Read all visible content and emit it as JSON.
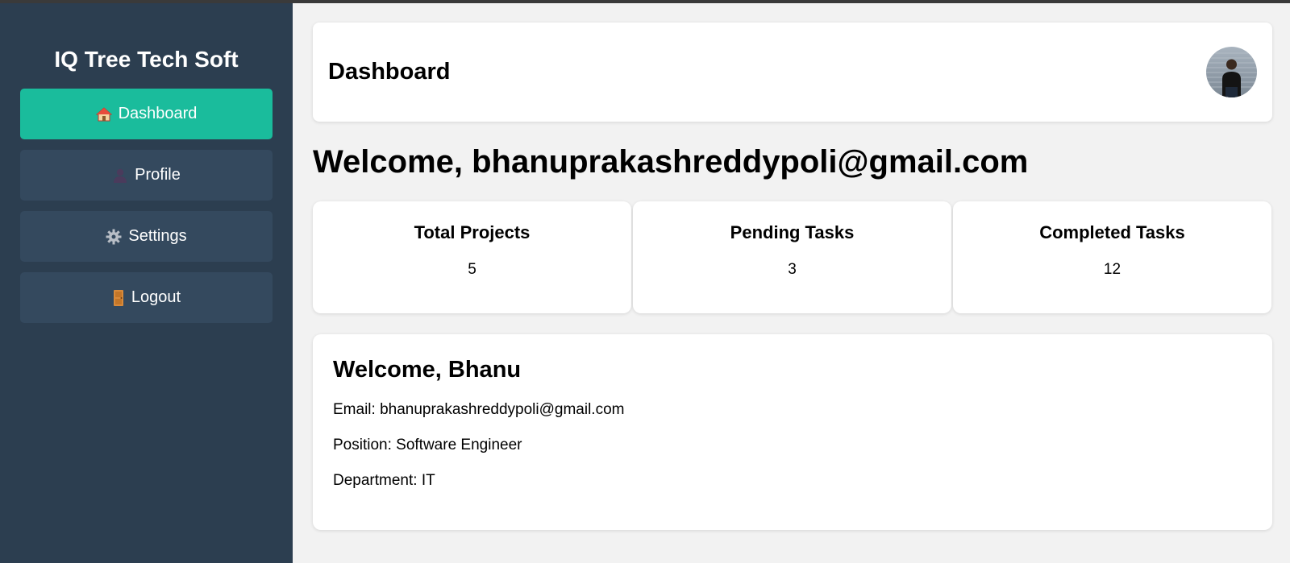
{
  "colors": {
    "sidebar_bg": "#2c3e50",
    "nav_item_bg": "#34495e",
    "nav_active_bg": "#1abc9c",
    "page_bg": "#f2f2f2",
    "card_bg": "#ffffff"
  },
  "sidebar": {
    "brand": "IQ Tree Tech Soft",
    "items": [
      {
        "label": "Dashboard",
        "icon": "house-icon",
        "active": true
      },
      {
        "label": "Profile",
        "icon": "user-icon",
        "active": false
      },
      {
        "label": "Settings",
        "icon": "gear-icon",
        "active": false
      },
      {
        "label": "Logout",
        "icon": "door-icon",
        "active": false
      }
    ]
  },
  "header": {
    "title": "Dashboard",
    "avatar_icon": "user-avatar"
  },
  "main": {
    "welcome": "Welcome, bhanuprakashreddypoli@gmail.com",
    "stats": [
      {
        "title": "Total Projects",
        "value": "5"
      },
      {
        "title": "Pending Tasks",
        "value": "3"
      },
      {
        "title": "Completed Tasks",
        "value": "12"
      }
    ],
    "profile": {
      "heading": "Welcome, Bhanu",
      "email": "Email: bhanuprakashreddypoli@gmail.com",
      "position": "Position: Software Engineer",
      "department": "Department: IT"
    }
  }
}
